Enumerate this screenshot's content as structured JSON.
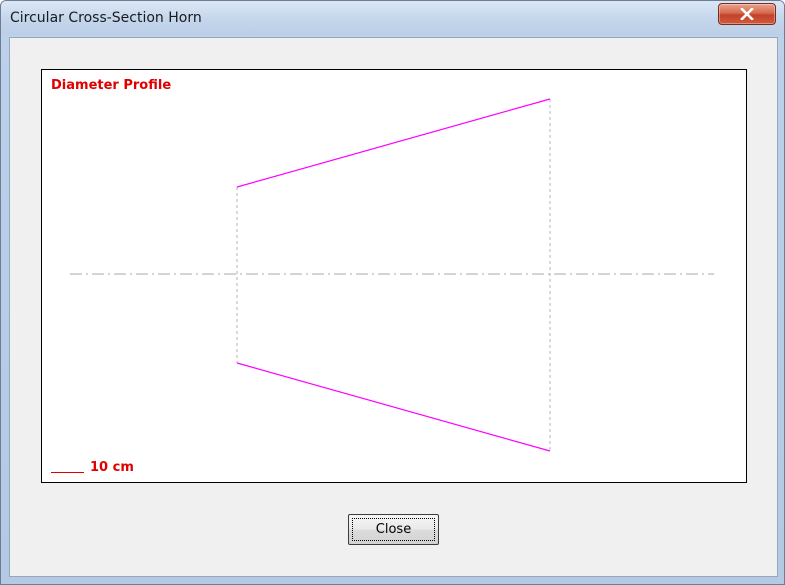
{
  "window": {
    "title": "Circular Cross-Section Horn",
    "close_icon": "close-x-icon"
  },
  "plot": {
    "title": "Diameter Profile",
    "scale_label": "10 cm",
    "colors": {
      "profile": "#ff00ff",
      "label": "#e00000",
      "axis": "#aaaaaa",
      "guides": "#b5b5b5"
    }
  },
  "buttons": {
    "close_label": "Close"
  }
}
